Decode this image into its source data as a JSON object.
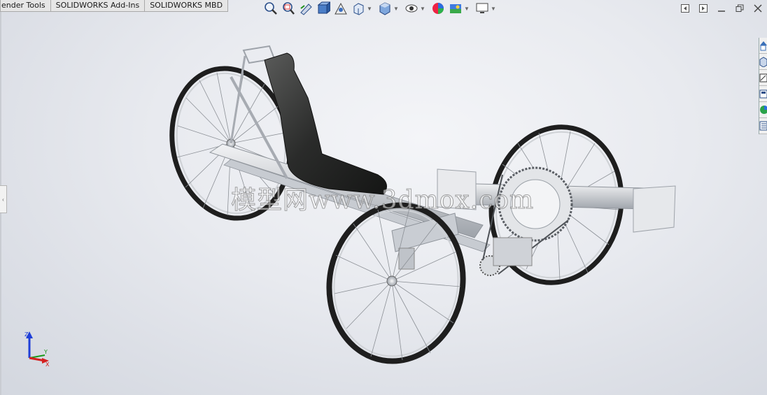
{
  "tabs": [
    {
      "label": "ender Tools"
    },
    {
      "label": "SOLIDWORKS Add-Ins"
    },
    {
      "label": "SOLIDWORKS MBD"
    }
  ],
  "hud_tools": [
    {
      "icon": "zoom-to-fit-icon"
    },
    {
      "icon": "zoom-to-area-icon"
    },
    {
      "icon": "previous-view-icon"
    },
    {
      "icon": "section-view-icon"
    },
    {
      "icon": "dynamic-annotation-icon"
    },
    {
      "icon": "view-orientation-icon"
    },
    {
      "icon": "display-style-icon"
    },
    {
      "icon": "hide-show-items-icon"
    },
    {
      "icon": "edit-appearance-icon"
    },
    {
      "icon": "apply-scene-icon"
    },
    {
      "icon": "view-settings-icon"
    }
  ],
  "taskpane_icons": [
    "resources-home-icon",
    "design-library-icon",
    "file-explorer-icon",
    "view-palette-icon",
    "appearances-icon",
    "custom-properties-icon"
  ],
  "watermark": "模型网www.3dmox.com",
  "triad": {
    "z": "Z",
    "y": "Y",
    "x": "X"
  },
  "colors": {
    "wheel_tire": "#1e1e1e",
    "frame": "#b8bcc2",
    "seat": "#2c2d2c",
    "axis_x": "#d42020",
    "axis_y": "#1a9a1a",
    "axis_z": "#1f3fd8"
  }
}
